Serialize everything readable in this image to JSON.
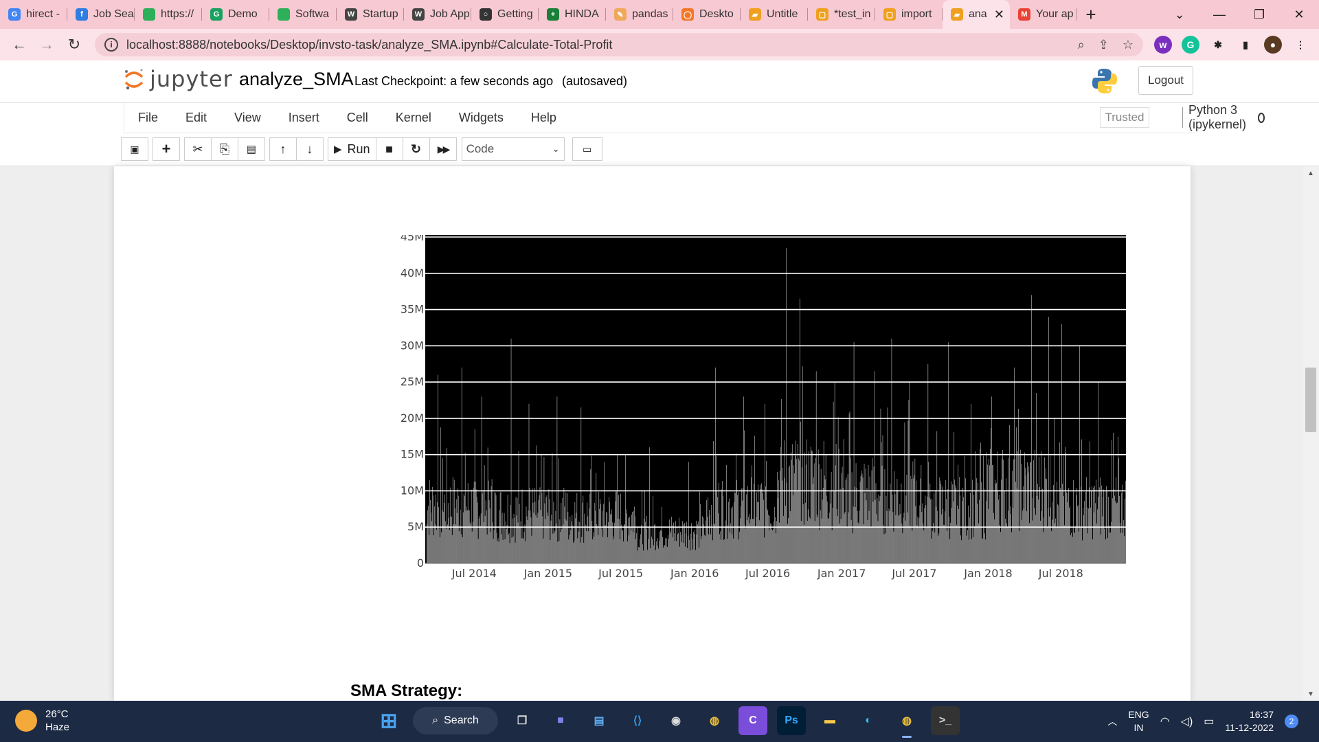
{
  "browser": {
    "tabs": [
      {
        "label": "hirect -",
        "fav_color": "#4285f4",
        "fav_char": "G"
      },
      {
        "label": "Job Sea",
        "fav_color": "#2f7de1",
        "fav_char": "f"
      },
      {
        "label": "https://",
        "fav_color": "#2eaf5a",
        "fav_char": ""
      },
      {
        "label": "Demo",
        "fav_color": "#1aa260",
        "fav_char": "G"
      },
      {
        "label": "Softwa",
        "fav_color": "#2eaf5a",
        "fav_char": ""
      },
      {
        "label": "Startup",
        "fav_color": "#444444",
        "fav_char": "W"
      },
      {
        "label": "Job App",
        "fav_color": "#444444",
        "fav_char": "W"
      },
      {
        "label": "Getting",
        "fav_color": "#333333",
        "fav_char": "○"
      },
      {
        "label": "HINDA",
        "fav_color": "#188038",
        "fav_char": "+"
      },
      {
        "label": "pandas",
        "fav_color": "#f0a95a",
        "fav_char": "✎"
      },
      {
        "label": "Deskto",
        "fav_color": "#f37726",
        "fav_char": "◯"
      },
      {
        "label": "Untitle",
        "fav_color": "#f0a020",
        "fav_char": "▰"
      },
      {
        "label": "*test_in",
        "fav_color": "#f0a020",
        "fav_char": "▢"
      },
      {
        "label": "import",
        "fav_color": "#f0a020",
        "fav_char": "▢"
      },
      {
        "label": "ana",
        "fav_color": "#f0a020",
        "fav_char": "▰",
        "active": true
      },
      {
        "label": "Your ap",
        "fav_color": "#ea4335",
        "fav_char": "M"
      }
    ],
    "new_tab": "+",
    "window_controls": [
      "⌄",
      "—",
      "❐",
      "✕"
    ],
    "url": "localhost:8888/notebooks/Desktop/invsto-task/analyze_SMA.ipynb#Calculate-Total-Profit",
    "nav": {
      "back": "←",
      "forward": "→",
      "reload": "↻"
    },
    "omnibox_icons": [
      "⌕",
      "⇪",
      "☆"
    ],
    "extensions": [
      {
        "char": "w",
        "color": "#7b2fbf"
      },
      {
        "char": "G",
        "color": "#15c39a"
      },
      {
        "char": "✱",
        "color": "#222222"
      },
      {
        "char": "▮",
        "color": "#222222"
      },
      {
        "char": "●",
        "color": "#5a3a22"
      },
      {
        "char": "⋮",
        "color": "#222222"
      }
    ]
  },
  "jupyter": {
    "logo_text": "jupyter",
    "notebook_name": "analyze_SMA",
    "checkpoint": "Last Checkpoint: a few seconds ago",
    "autosaved": "(autosaved)",
    "logout_label": "Logout",
    "menus": [
      "File",
      "Edit",
      "View",
      "Insert",
      "Cell",
      "Kernel",
      "Widgets",
      "Help"
    ],
    "trusted_label": "Trusted",
    "kernel_label": "Python 3 (ipykernel)",
    "toolbar": {
      "save": "💾",
      "add": "+",
      "cut": "✂",
      "copy": "⎘",
      "paste": "📋",
      "up": "↑",
      "down": "↓",
      "run": "Run",
      "run_icon": "▶",
      "stop": "■",
      "restart": "↻",
      "fastforward": "⏩",
      "cell_type": "Code",
      "keyboard": "⌨"
    }
  },
  "chart_data": {
    "type": "bar",
    "background": "#000000",
    "bar_color": "#d8d8d8",
    "grid": true,
    "ylim": [
      0,
      45000000
    ],
    "yticks": [
      "0",
      "5M",
      "10M",
      "15M",
      "20M",
      "25M",
      "30M",
      "35M",
      "40M",
      "45M"
    ],
    "xticks": [
      "Jul 2014",
      "Jan 2015",
      "Jul 2015",
      "Jan 2016",
      "Jul 2016",
      "Jan 2017",
      "Jul 2017",
      "Jan 2018",
      "Jul 2018"
    ],
    "x_range": [
      "2014-03",
      "2018-12"
    ],
    "series": [
      {
        "period": "2014 H1",
        "typical": 9000000,
        "peaks": [
          26000000,
          27000000,
          23000000
        ]
      },
      {
        "period": "2014 H2",
        "typical": 8000000,
        "peaks": [
          31000000,
          22000000,
          23000000
        ]
      },
      {
        "period": "2015 H1",
        "typical": 7500000,
        "peaks": [
          21500000,
          15000000
        ]
      },
      {
        "period": "2015 H2",
        "typical": 5000000,
        "peaks": [
          16000000,
          14000000
        ]
      },
      {
        "period": "2016 H1",
        "typical": 9000000,
        "peaks": [
          27000000,
          23000000,
          22000000
        ]
      },
      {
        "period": "2016 H2",
        "typical": 13000000,
        "peaks": [
          43500000,
          36500000,
          26500000,
          25000000
        ]
      },
      {
        "period": "2017 H1",
        "typical": 11000000,
        "peaks": [
          30500000,
          26500000,
          31000000,
          25000000
        ]
      },
      {
        "period": "2017 H2",
        "typical": 9000000,
        "peaks": [
          27500000,
          30500000,
          22000000
        ]
      },
      {
        "period": "2018 H1",
        "typical": 12000000,
        "peaks": [
          23000000,
          27000000,
          37000000,
          34000000
        ]
      },
      {
        "period": "2018 H2",
        "typical": 9000000,
        "peaks": [
          33000000,
          30000000,
          25000000,
          18000000
        ]
      }
    ]
  },
  "notebook": {
    "heading": "SMA Strategy:"
  },
  "taskbar": {
    "temp": "26°C",
    "condition": "Haze",
    "search_label": "Search",
    "lang_top": "ENG",
    "lang_bottom": "IN",
    "time": "16:37",
    "date": "11-12-2022",
    "notifications": "2",
    "apps": [
      {
        "name": "start",
        "char": "⊞",
        "color": "#4aa3f0",
        "bg": "transparent"
      },
      {
        "name": "task-view",
        "char": "❐",
        "color": "#dddddd",
        "bg": "transparent"
      },
      {
        "name": "meet",
        "char": "■",
        "color": "#7b83eb",
        "bg": "transparent"
      },
      {
        "name": "notepad",
        "char": "▤",
        "color": "#5fb0f5",
        "bg": "transparent"
      },
      {
        "name": "vscode",
        "char": "⟨⟩",
        "color": "#2f9be8",
        "bg": "transparent"
      },
      {
        "name": "obs",
        "char": "◉",
        "color": "#dddddd",
        "bg": "transparent"
      },
      {
        "name": "chrome",
        "char": "◍",
        "color": "#f2c230",
        "bg": "transparent"
      },
      {
        "name": "canva",
        "char": "C",
        "color": "#ffffff",
        "bg": "#7b4ddb"
      },
      {
        "name": "photoshop",
        "char": "Ps",
        "color": "#31a8ff",
        "bg": "#001e36"
      },
      {
        "name": "file-explorer",
        "char": "▬",
        "color": "#f7c948",
        "bg": "transparent"
      },
      {
        "name": "edge",
        "char": "◐",
        "color": "#35c1f1",
        "bg": "transparent"
      },
      {
        "name": "chrome-active",
        "char": "◍",
        "color": "#f2c230",
        "bg": "transparent",
        "active": true
      },
      {
        "name": "terminal",
        "char": ">_",
        "color": "#dddddd",
        "bg": "#333333"
      }
    ]
  }
}
